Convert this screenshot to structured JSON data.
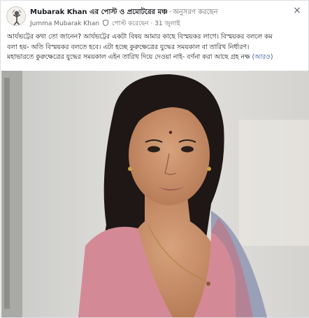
{
  "post": {
    "group_title": "Mubarak Khan এর পোস্ট ও প্রমোটরের মঞ্চ",
    "follow_label": "অনুসরণ করছেন",
    "author": "Jumma Mubarak Khan",
    "posted_label": "পোস্ট করেছেন",
    "date": "31 জুলাই",
    "close_label": "×",
    "body_lines": [
      "আর্যভট্টের কথা তো জানেন? আর্যভট্টের একটা বিষয় আমার কাছে বিস্ময়কর লাগে। বিস্ময়কর বললে কম",
      "বলা হয়- অতি বিস্ময়কর বলতে হবে। এটা হচ্ছে কুরুক্ষেত্রের যুদ্ধের সময়কাল বা তারিখ নির্ধারণ।",
      "মহাভারতে কুরুক্ষেত্রের যুদ্ধের সময়কাল এইন তারিখ দিয়ে দেওয়া নাই- বর্ণনা করা আছে গ্রহ নক্ষ"
    ],
    "see_more": "(আরও)"
  },
  "icons": {
    "avatar": "group-avatar-icon",
    "shield": "admin-shield-icon",
    "close": "close-icon"
  },
  "colors": {
    "link": "#385898",
    "secondary_text": "#65676b",
    "background": "#ffffff"
  }
}
